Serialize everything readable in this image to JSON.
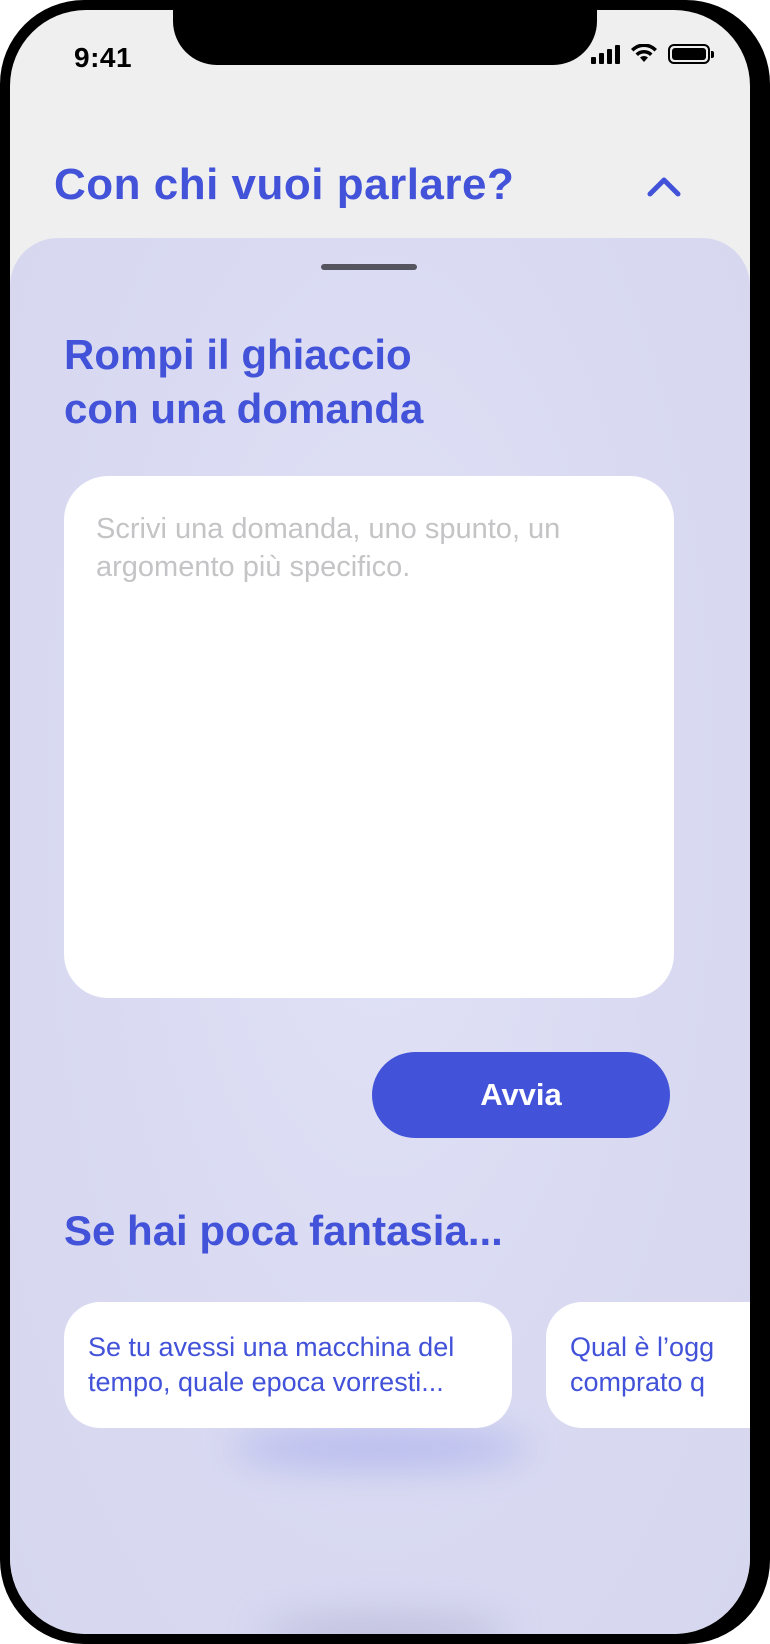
{
  "status_bar": {
    "time": "9:41"
  },
  "header": {
    "title": "Con chi vuoi parlare?"
  },
  "sheet": {
    "heading_line1": "Rompi il ghiaccio",
    "heading_line2": "con una domanda",
    "question_placeholder": "Scrivi una domanda, uno spunto, un argomento più specifico.",
    "start_label": "Avvia",
    "suggestions_heading": "Se hai poca fantasia...",
    "suggestions": [
      {
        "line1": "Se tu avessi una macchina del",
        "line2": "tempo, quale epoca vorresti..."
      },
      {
        "line1": "Qual è l’ogg",
        "line2": "comprato q"
      }
    ]
  },
  "colors": {
    "accent": "#4252d9",
    "sheet_bg": "#dcddf4",
    "status_bg": "#efeff0"
  },
  "icons": {
    "collapse": "chevron-up-icon",
    "signal": "cellular-signal-icon",
    "wifi": "wifi-icon",
    "battery": "battery-icon"
  }
}
